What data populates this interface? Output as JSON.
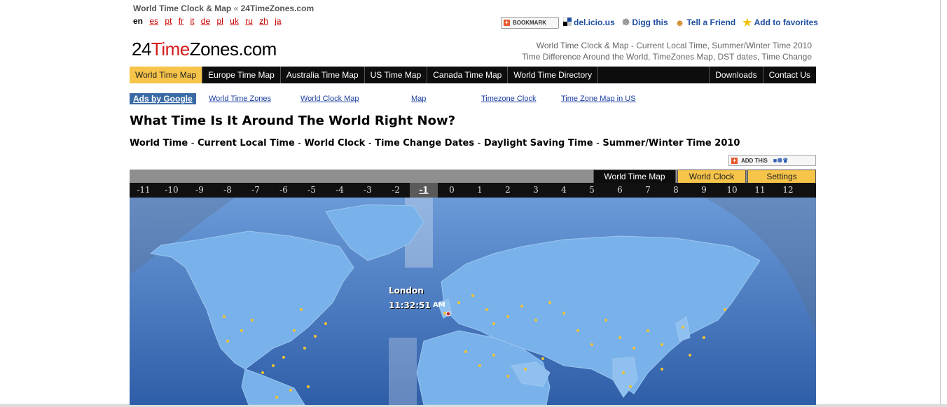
{
  "breadcrumb": {
    "link": "World Time Clock & Map",
    "sep": "«",
    "site": "24TimeZones.com"
  },
  "languages": {
    "current": "en",
    "links": [
      "es",
      "pt",
      "fr",
      "it",
      "de",
      "pl",
      "uk",
      "ru",
      "zh",
      "ja"
    ]
  },
  "social": {
    "bookmark": "BOOKMARK",
    "delicious": "del.icio.us",
    "digg": "Digg this",
    "tell_friend": "Tell a Friend",
    "favorites": "Add to favorites"
  },
  "logo": {
    "prefix": "24",
    "red": "Time",
    "suffix": "Zones.com"
  },
  "tagline": {
    "line1": "World Time Clock & Map - Current Local Time, Summer/Winter Time 2010",
    "line2": "Time Difference Around the World, TimeZones Map, DST dates, Time Change"
  },
  "nav": [
    "World Time Map",
    "Europe Time Map",
    "Australia Time Map",
    "US Time Map",
    "Canada Time Map",
    "World Time Directory"
  ],
  "nav_right": [
    "Downloads",
    "Contact Us"
  ],
  "ads": {
    "label": "Ads by Google",
    "links": [
      "World Time Zones",
      "World Clock Map",
      "Map",
      "Timezone Clock",
      "Time Zone Map in US"
    ]
  },
  "heading": "What Time Is It Around The World Right Now?",
  "subheading": {
    "items": [
      "World Time",
      "Current Local Time",
      "World Clock",
      "Time Change Dates",
      "Daylight Saving Time",
      "Summer/Winter Time 2010"
    ],
    "sep": "-"
  },
  "addthis": "ADD THIS",
  "map": {
    "tabs": [
      "World Time Map",
      "World Clock",
      "Settings"
    ],
    "active_tab": "World Time Map",
    "timezones": [
      "-11",
      "-10",
      "-9",
      "-8",
      "-7",
      "-6",
      "-5",
      "-4",
      "-3",
      "-2",
      "-1",
      "0",
      "1",
      "2",
      "3",
      "4",
      "5",
      "6",
      "7",
      "8",
      "9",
      "10",
      "11",
      "12"
    ],
    "current_zone": "-1",
    "city": {
      "name": "London",
      "time": "11:32:51",
      "ampm": "AM"
    }
  },
  "colors": {
    "nav_active": "#f7c44a",
    "ocean": "#3b6db3",
    "land": "#79b2ea",
    "city_dot": "#f2c230"
  }
}
